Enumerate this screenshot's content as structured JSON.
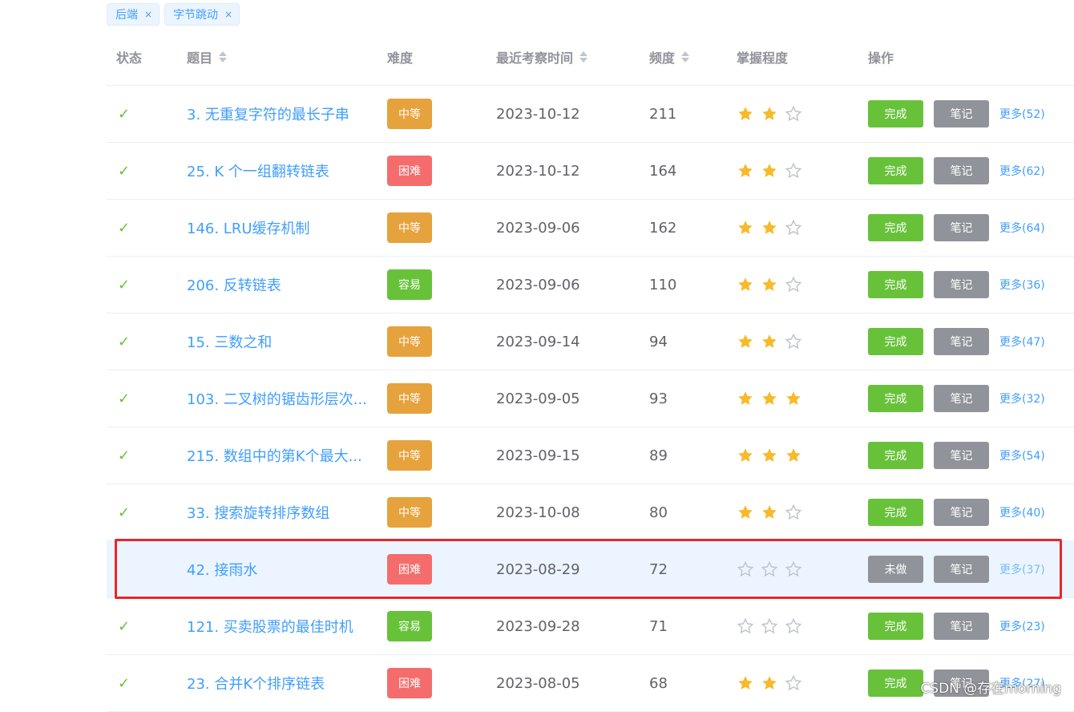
{
  "filters": [
    {
      "label": "后端",
      "close": "×"
    },
    {
      "label": "字节跳动",
      "close": "×"
    }
  ],
  "columns": {
    "status": "状态",
    "title": "题目",
    "difficulty": "难度",
    "last_exam": "最近考察时间",
    "frequency": "频度",
    "mastery": "掌握程度",
    "actions": "操作"
  },
  "rows": [
    {
      "done": true,
      "check": "✓",
      "title": "3. 无重复字符的最长子串",
      "difficulty": "中等",
      "diff_color": "#e6a23c",
      "date": "2023-10-12",
      "freq": "211",
      "stars": 2,
      "status_btn": "完成",
      "note_btn": "笔记",
      "more": "更多(52)"
    },
    {
      "done": true,
      "check": "✓",
      "title": "25. K 个一组翻转链表",
      "difficulty": "困难",
      "diff_color": "#f56c6c",
      "date": "2023-10-12",
      "freq": "164",
      "stars": 2,
      "status_btn": "完成",
      "note_btn": "笔记",
      "more": "更多(62)"
    },
    {
      "done": true,
      "check": "✓",
      "title": "146. LRU缓存机制",
      "difficulty": "中等",
      "diff_color": "#e6a23c",
      "date": "2023-09-06",
      "freq": "162",
      "stars": 2,
      "status_btn": "完成",
      "note_btn": "笔记",
      "more": "更多(64)"
    },
    {
      "done": true,
      "check": "✓",
      "title": "206. 反转链表",
      "difficulty": "容易",
      "diff_color": "#67c23a",
      "date": "2023-09-06",
      "freq": "110",
      "stars": 2,
      "status_btn": "完成",
      "note_btn": "笔记",
      "more": "更多(36)"
    },
    {
      "done": true,
      "check": "✓",
      "title": "15. 三数之和",
      "difficulty": "中等",
      "diff_color": "#e6a23c",
      "date": "2023-09-14",
      "freq": "94",
      "stars": 2,
      "status_btn": "完成",
      "note_btn": "笔记",
      "more": "更多(47)"
    },
    {
      "done": true,
      "check": "✓",
      "title": "103. 二叉树的锯齿形层次...",
      "difficulty": "中等",
      "diff_color": "#e6a23c",
      "date": "2023-09-05",
      "freq": "93",
      "stars": 3,
      "status_btn": "完成",
      "note_btn": "笔记",
      "more": "更多(32)"
    },
    {
      "done": true,
      "check": "✓",
      "title": "215. 数组中的第K个最大...",
      "difficulty": "中等",
      "diff_color": "#e6a23c",
      "date": "2023-09-15",
      "freq": "89",
      "stars": 3,
      "status_btn": "完成",
      "note_btn": "笔记",
      "more": "更多(54)"
    },
    {
      "done": true,
      "check": "✓",
      "title": "33. 搜索旋转排序数组",
      "difficulty": "中等",
      "diff_color": "#e6a23c",
      "date": "2023-10-08",
      "freq": "80",
      "stars": 2,
      "status_btn": "完成",
      "note_btn": "笔记",
      "more": "更多(40)"
    },
    {
      "done": false,
      "check": "",
      "title": "42. 接雨水",
      "difficulty": "困难",
      "diff_color": "#f56c6c",
      "date": "2023-08-29",
      "freq": "72",
      "stars": 0,
      "status_btn": "未做",
      "note_btn": "笔记",
      "more": "更多(37)"
    },
    {
      "done": true,
      "check": "✓",
      "title": "121. 买卖股票的最佳时机",
      "difficulty": "容易",
      "diff_color": "#67c23a",
      "date": "2023-09-28",
      "freq": "71",
      "stars": 0,
      "status_btn": "完成",
      "note_btn": "笔记",
      "more": "更多(23)"
    },
    {
      "done": true,
      "check": "✓",
      "title": "23. 合并K个排序链表",
      "difficulty": "困难",
      "diff_color": "#f56c6c",
      "date": "2023-08-05",
      "freq": "68",
      "stars": 2,
      "status_btn": "完成",
      "note_btn": "笔记",
      "more": "更多(27)"
    }
  ],
  "star_colors": {
    "filled": "#f7ba2a",
    "empty": "#c0c4cc"
  },
  "watermark": "CSDN @存在morning"
}
